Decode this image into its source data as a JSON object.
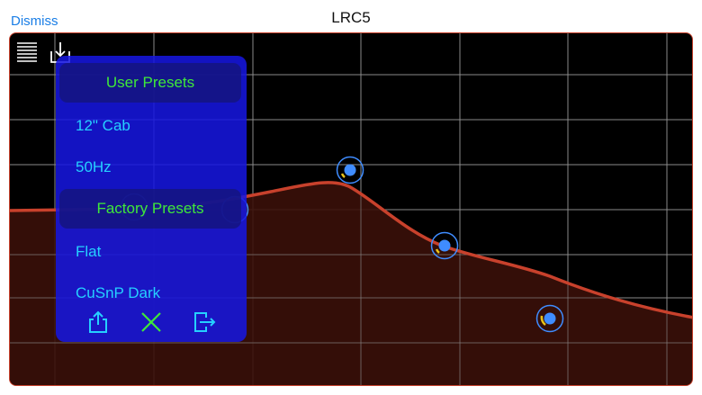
{
  "header": {
    "dismiss_label": "Dismiss",
    "title": "LRC5"
  },
  "toolbar": {
    "list_icon": "list-icon",
    "import_icon": "download-tray-icon"
  },
  "presets_menu": {
    "user_section": "User Presets",
    "user_items": [
      "12\" Cab",
      "50Hz"
    ],
    "factory_section": "Factory Presets",
    "factory_items": [
      "Flat",
      "CuSnP Dark"
    ],
    "actions": [
      "share-icon",
      "close-icon",
      "export-icon"
    ]
  },
  "colors": {
    "curve": "#c8412c",
    "curve_fill": "#3a1009",
    "grid": "#8a8a8a",
    "knob": "#3f8cff",
    "menu_bg": "#1616e2",
    "section_text": "#3ee83a",
    "item_text": "#25d0ff",
    "accent": "#1a7ee6"
  }
}
